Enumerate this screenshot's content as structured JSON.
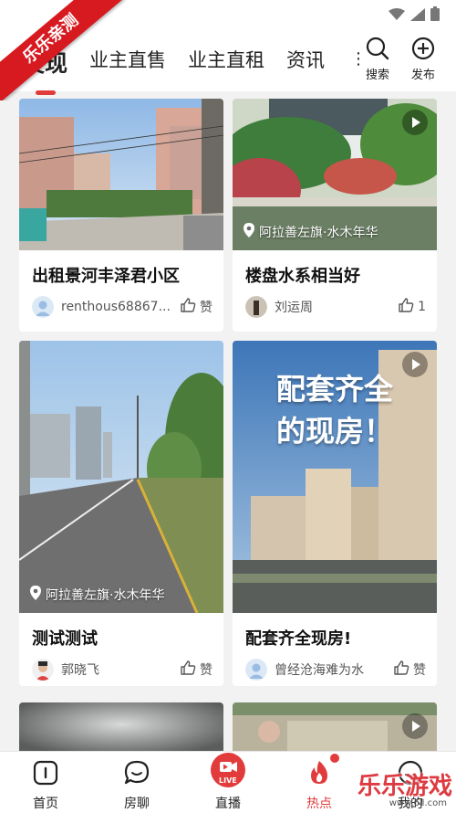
{
  "watermark_corner": "乐乐亲测",
  "header": {
    "tabs": [
      {
        "label": "发现",
        "active": true
      },
      {
        "label": "业主直售",
        "active": false
      },
      {
        "label": "业主直租",
        "active": false
      },
      {
        "label": "资讯",
        "active": false
      }
    ],
    "more": "⋮",
    "search_label": "搜索",
    "publish_label": "发布"
  },
  "feed": {
    "cards": [
      {
        "title": "出租景河丰泽君小区",
        "author": "renthous68867...",
        "like_label": "赞",
        "location": ""
      },
      {
        "title": "楼盘水系相当好",
        "author": "刘运周",
        "like_label": "1",
        "location": "阿拉善左旗·水木年华"
      },
      {
        "title": "测试测试",
        "author": "郭晓飞",
        "like_label": "赞",
        "location": "阿拉善左旗·水木年华"
      },
      {
        "title": "配套齐全现房!",
        "author": "曾经沧海难为水",
        "like_label": "赞",
        "location": "",
        "overlay_text_1": "配套齐全",
        "overlay_text_2": "的现房！"
      }
    ]
  },
  "bottom_nav": {
    "items": [
      {
        "label": "首页"
      },
      {
        "label": "房聊"
      },
      {
        "label": "直播",
        "badge": "LIVE"
      },
      {
        "label": "热点",
        "active": true
      },
      {
        "label": "我的"
      }
    ]
  },
  "watermark_br": {
    "text": "乐乐游戏",
    "sub": "www.6ll.com"
  },
  "colors": {
    "accent": "#e23b3b",
    "brand_red": "#d71920"
  }
}
